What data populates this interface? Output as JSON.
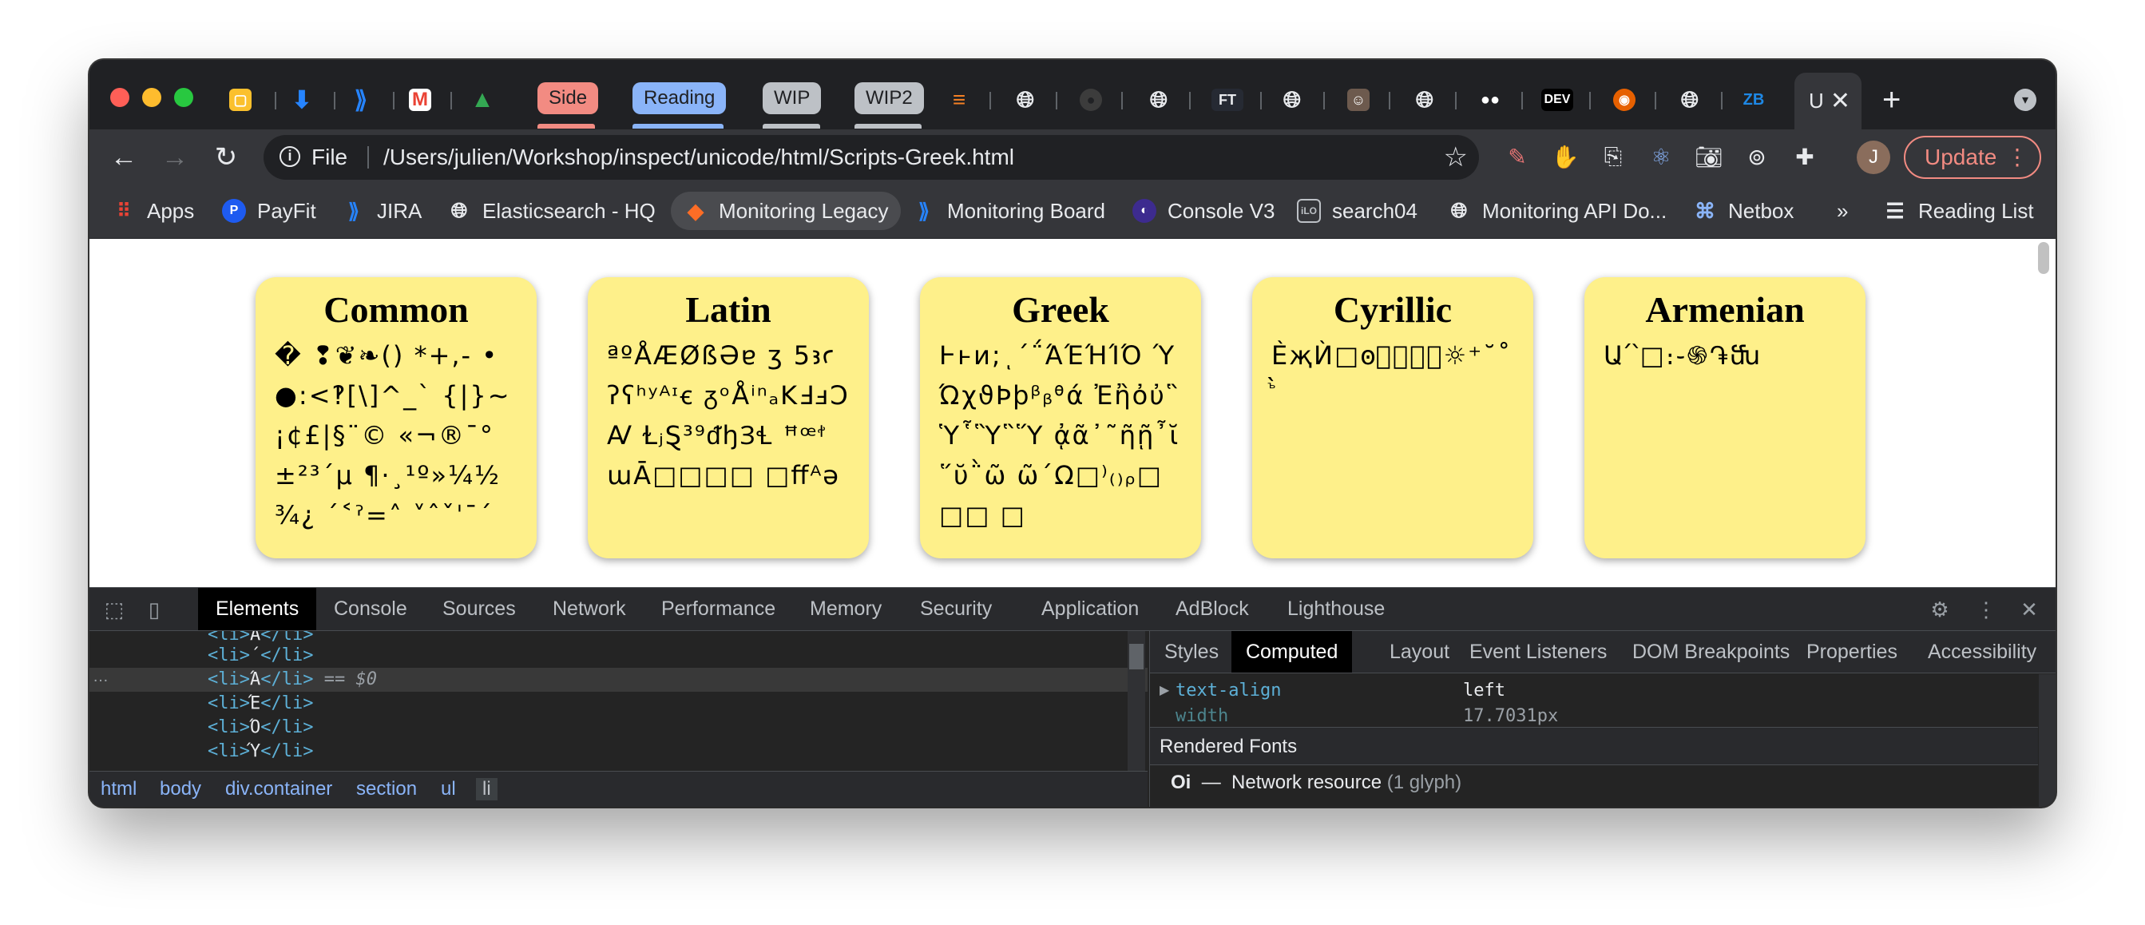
{
  "window": {
    "active_tab_label": "U"
  },
  "tabs": {
    "groups": [
      {
        "label": "Side",
        "bg": "#f28b82",
        "fg": "#202124"
      },
      {
        "label": "Reading",
        "bg": "#8ab4f8",
        "fg": "#202124"
      },
      {
        "label": "WIP",
        "bg": "#bdc1c6",
        "fg": "#202124"
      },
      {
        "label": "WIP2",
        "bg": "#bdc1c6",
        "fg": "#202124"
      }
    ],
    "favicons": [
      "notes-icon",
      "drive-arrow-icon",
      "jira-icon",
      "gmail-icon",
      "google-drive-icon",
      "stackoverflow-icon",
      "globe-icon",
      "github-icon",
      "globe-icon",
      "ft-icon",
      "globe-icon",
      "avatar-icon",
      "globe-icon",
      "medium-icon",
      "dev-icon",
      "firefox-icon",
      "globe-icon",
      "zb-icon"
    ],
    "ft_text": "FT",
    "dev_text": "DEV",
    "zb_text": "ZB"
  },
  "toolbar": {
    "file_label": "File",
    "url": "/Users/julien/Workshop/inspect/unicode/html/Scripts-Greek.html",
    "avatar_initial": "J",
    "update_label": "Update"
  },
  "bookmarks": [
    {
      "label": "Apps",
      "icon": "apps-grid-icon"
    },
    {
      "label": "PayFit",
      "icon": "payfit-icon"
    },
    {
      "label": "JIRA",
      "icon": "jira-icon"
    },
    {
      "label": "Elasticsearch - HQ",
      "icon": "globe-icon"
    },
    {
      "label": "Monitoring Legacy",
      "icon": "gitlab-icon"
    },
    {
      "label": "Monitoring Board",
      "icon": "jira-icon"
    },
    {
      "label": "Console V3",
      "icon": "console-icon"
    },
    {
      "label": "search04",
      "icon": "ilo-icon"
    },
    {
      "label": "Monitoring API Do...",
      "icon": "globe-icon"
    },
    {
      "label": "Netbox",
      "icon": "netbox-icon"
    }
  ],
  "bookmarks_more": "»",
  "reading_list": "Reading List",
  "ilo_text": "iLO",
  "cards": [
    {
      "title": "Common",
      "glyphs": "� ❢❦❧() *+,- •●:<‽[\\]^_` {|}~ ¡¢£|§¨© «¬®¯°±²³´µ ¶·¸¹º»¼½¾¿ ´˂ˀ=˄ ˅ˆˇˈˉˊ"
    },
    {
      "title": "Latin",
      "glyphs": "ªºÅÆØßƏɐ ʒ 5ꜣꜥʔʕʰʸᴬᶦꞓ ᵹᵒÅⁱⁿₐKℲⅎↃꜸ ⱢⱼⱾ³⁹ᵭꜧꞫꞭ ꟸꟹꭝɯᾹ□□□□ □ﬀᴬə"
    },
    {
      "title": "Greek",
      "glyphs": "Ͱͱͷ;ͺ΄΅ΆΈΉΊΌ ΎΏχϑϷϸᵝᵦᶿά Ἐἢὀὐ῝Ὑ῟Ὓ῝Ὕ ᾀᾶ᾿῀ῆῇ῏ῐ῞ῠ῭ῶ ῶ΄Ω□⁾₍₎ᵨ□□□ □"
    },
    {
      "title": "Cyrillic",
      "glyphs": "ЀҗЍ□ꙩꙺᲀꚚꚜ☼⁺˘˚ ꙸ̀"
    },
    {
      "title": "Armenian",
      "glyphs": "Ա՛՝□։֊֍֏ﬓ"
    }
  ],
  "devtools": {
    "tabs": [
      "Elements",
      "Console",
      "Sources",
      "Network",
      "Performance",
      "Memory",
      "Security",
      "Application",
      "AdBlock",
      "Lighthouse"
    ],
    "active_tab": "Elements",
    "element_lines": [
      {
        "open": "<li>",
        "text": "Ά",
        "close": "</li>"
      },
      {
        "open": "<li>",
        "text": "΄",
        "close": "</li>"
      },
      {
        "open": "<li>",
        "text": "Ά",
        "close": "</li>",
        "selected": " == $0"
      },
      {
        "open": "<li>",
        "text": "Έ",
        "close": "</li>"
      },
      {
        "open": "<li>",
        "text": "Ό",
        "close": "</li>"
      },
      {
        "open": "<li>",
        "text": "Ύ",
        "close": "</li>"
      }
    ],
    "breadcrumbs": [
      "html",
      "body",
      "div.container",
      "section",
      "ul",
      "li"
    ],
    "side_tabs": [
      "Styles",
      "Computed",
      "Layout",
      "Event Listeners",
      "DOM Breakpoints",
      "Properties",
      "Accessibility"
    ],
    "side_active": "Computed",
    "computed": [
      {
        "prop": "text-align",
        "value": "left",
        "prop_color": "#5db0d7"
      },
      {
        "prop": "width",
        "value": "17.7031px",
        "prop_color": "#5aa5b0"
      }
    ],
    "rendered_fonts_label": "Rendered Fonts",
    "font_row": {
      "sample": "Oi",
      "dash": "—",
      "name": "Network resource",
      "count": "(1 glyph)"
    }
  }
}
